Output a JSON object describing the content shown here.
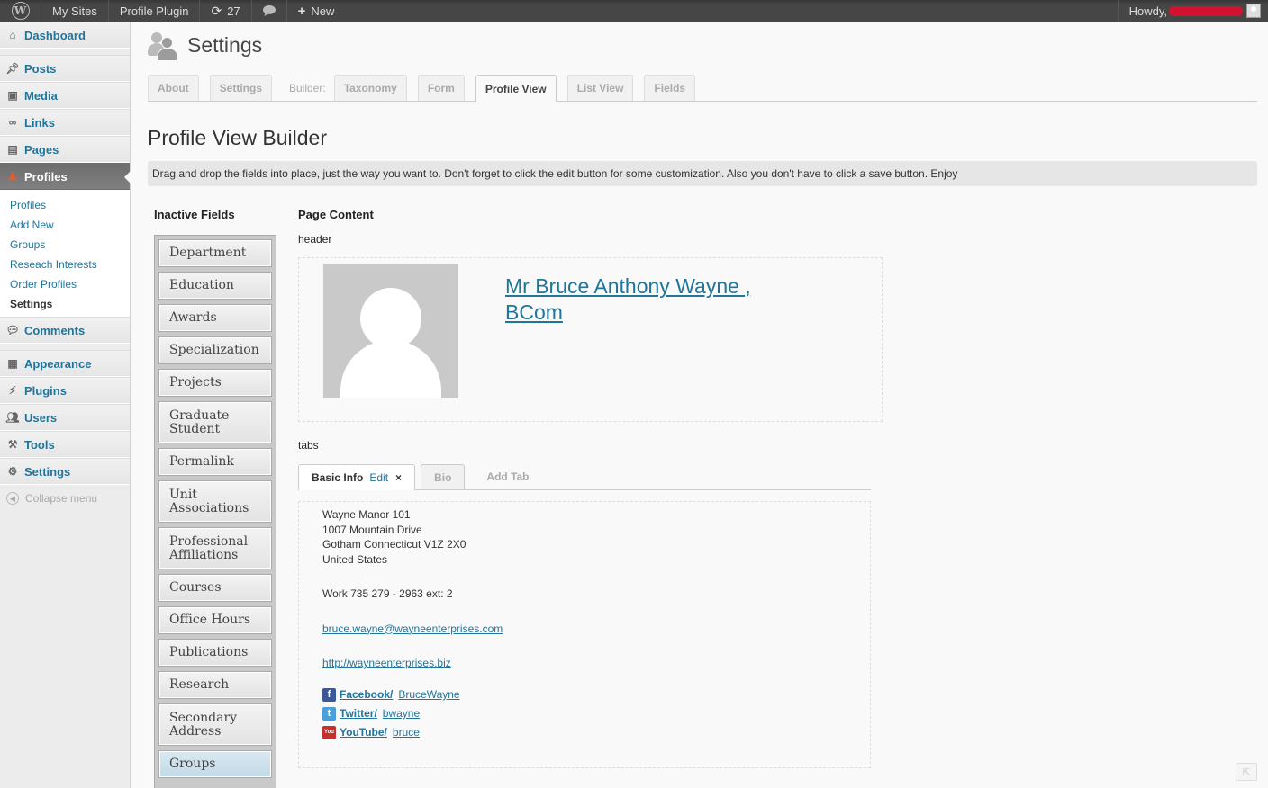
{
  "adminbar": {
    "logo_icon": "wordpress-icon",
    "my_sites": "My Sites",
    "site_name": "Profile Plugin",
    "updates_count": "27",
    "new_label": "New",
    "howdy": "Howdy,"
  },
  "sidebar": {
    "dashboard": "Dashboard",
    "posts": "Posts",
    "media": "Media",
    "links": "Links",
    "pages": "Pages",
    "profiles": "Profiles",
    "submenu": {
      "profiles": "Profiles",
      "add_new": "Add New",
      "groups": "Groups",
      "research": "Reseach Interests",
      "order": "Order Profiles",
      "settings": "Settings"
    },
    "comments": "Comments",
    "appearance": "Appearance",
    "plugins": "Plugins",
    "users": "Users",
    "tools": "Tools",
    "settings": "Settings",
    "collapse": "Collapse menu"
  },
  "page": {
    "title": "Settings",
    "tabs": {
      "about": "About",
      "settings": "Settings",
      "builder_label": "Builder:",
      "taxonomy": "Taxonomy",
      "form": "Form",
      "profile_view": "Profile View",
      "list_view": "List View",
      "fields": "Fields"
    },
    "heading": "Profile View Builder",
    "notice": "Drag and drop the fields into place, just the way you want to. Don't forget to click the edit button for some customization. Also you don't have to click a save button. Enjoy"
  },
  "inactive": {
    "title": "Inactive Fields",
    "fields": [
      "Department",
      "Education",
      "Awards",
      "Specialization",
      "Projects",
      "Graduate Student",
      "Permalink",
      "Unit Associations",
      "Professional Affiliations",
      "Courses",
      "Office Hours",
      "Publications",
      "Research",
      "Secondary Address",
      "Groups"
    ]
  },
  "content": {
    "title": "Page Content",
    "header_label": "header",
    "name": "Mr  Bruce  Anthony  Wayne ,  BCom",
    "tabs_label": "tabs",
    "tab_basic": "Basic Info",
    "tab_edit": "Edit",
    "tab_close": "×",
    "tab_bio": "Bio",
    "tab_add": "Add Tab",
    "address1": "Wayne Manor  101",
    "address2": "1007 Mountain Drive",
    "address3": "Gotham  Connecticut  V1Z 2X0",
    "address4": "United States",
    "phone": "Work  735  279  -  2963  ext:  2",
    "email": "bruce.wayne@wayneenterprises.com",
    "website": "http://wayneenterprises.biz",
    "facebook_label": "Facebook/",
    "facebook_user": "BruceWayne",
    "twitter_label": "Twitter/",
    "twitter_user": "bwayne",
    "youtube_label": "YouTube/",
    "youtube_user": "bruce"
  },
  "colors": {
    "link": "#21759b",
    "adminbar": "#464646",
    "redaction": "#d2122e",
    "facebook": "#3b5998",
    "twitter": "#4a9ed9",
    "youtube": "#c4302b"
  }
}
